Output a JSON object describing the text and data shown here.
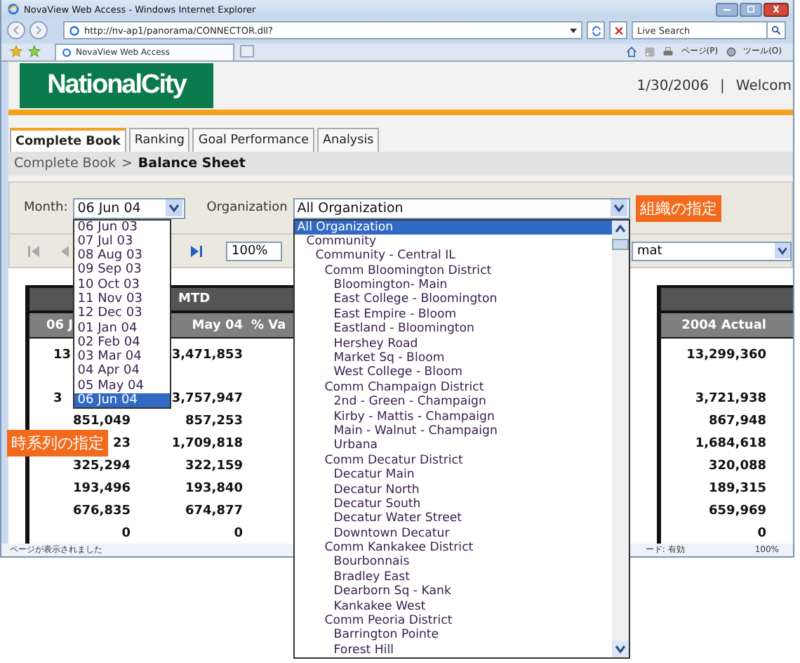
{
  "window": {
    "title": "NovaView Web Access - Windows Internet Explorer"
  },
  "address_bar": {
    "url": "http://nv-ap1/panorama/CONNECTOR.dll?"
  },
  "search": {
    "placeholder": "Live Search"
  },
  "browser_tabs": [
    {
      "label": "NovaView Web Access",
      "selected": true
    }
  ],
  "command_bar": [
    "ページ(P)",
    "ツール(O)"
  ],
  "header": {
    "logo": "NationalCity",
    "date": "1/30/2006",
    "separator": "|",
    "welcome": "Welcom"
  },
  "tabs": [
    {
      "label": "Complete Book",
      "selected": true
    },
    {
      "label": "Ranking",
      "selected": false
    },
    {
      "label": "Goal Performance",
      "selected": false
    },
    {
      "label": "Analysis",
      "selected": false
    }
  ],
  "breadcrumb": {
    "parent": "Complete Book",
    "separator": ">",
    "current": "Balance Sheet"
  },
  "filters": {
    "month": {
      "label": "Month:",
      "value": "06 Jun 04",
      "callout": "時系列の指定",
      "options": [
        {
          "label": "06 Jun 03",
          "selected": false
        },
        {
          "label": "07 Jul 03",
          "selected": false
        },
        {
          "label": "08 Aug 03",
          "selected": false
        },
        {
          "label": "09 Sep 03",
          "selected": false
        },
        {
          "label": "10 Oct 03",
          "selected": false
        },
        {
          "label": "11 Nov 03",
          "selected": false
        },
        {
          "label": "12 Dec 03",
          "selected": false
        },
        {
          "label": "01 Jan 04",
          "selected": false
        },
        {
          "label": "02 Feb 04",
          "selected": false
        },
        {
          "label": "03 Mar 04",
          "selected": false
        },
        {
          "label": "04 Apr 04",
          "selected": false
        },
        {
          "label": "05 May 04",
          "selected": false
        },
        {
          "label": "06 Jun 04",
          "selected": true
        }
      ]
    },
    "organization": {
      "label": "Organization",
      "value": "All Organization",
      "callout": "組織の指定",
      "options": [
        {
          "label": "All Organization",
          "selected": true,
          "children": [
            {
              "label": "Community",
              "selected": false,
              "children": [
                {
                  "label": "Community - Central IL",
                  "selected": false,
                  "children": [
                    {
                      "label": "Comm Bloomington District",
                      "selected": false,
                      "children": [
                        {
                          "label": "Bloomington- Main",
                          "selected": false
                        },
                        {
                          "label": "East College - Bloomington",
                          "selected": false
                        },
                        {
                          "label": "East Empire - Bloom",
                          "selected": false
                        },
                        {
                          "label": "Eastland - Bloomington",
                          "selected": false
                        },
                        {
                          "label": "Hershey Road",
                          "selected": false
                        },
                        {
                          "label": "Market Sq - Bloom",
                          "selected": false
                        },
                        {
                          "label": "West College - Bloom",
                          "selected": false
                        }
                      ]
                    },
                    {
                      "label": "Comm Champaign District",
                      "selected": false,
                      "children": [
                        {
                          "label": "2nd - Green - Champaign",
                          "selected": false
                        },
                        {
                          "label": "Kirby - Mattis - Champaign",
                          "selected": false
                        },
                        {
                          "label": "Main - Walnut - Champaign",
                          "selected": false
                        },
                        {
                          "label": "Urbana",
                          "selected": false
                        }
                      ]
                    },
                    {
                      "label": "Comm Decatur District",
                      "selected": false,
                      "children": [
                        {
                          "label": "Decatur Main",
                          "selected": false
                        },
                        {
                          "label": "Decatur North",
                          "selected": false
                        },
                        {
                          "label": "Decatur South",
                          "selected": false
                        },
                        {
                          "label": "Decatur Water Street",
                          "selected": false
                        },
                        {
                          "label": "Downtown Decatur",
                          "selected": false
                        }
                      ]
                    },
                    {
                      "label": "Comm Kankakee District",
                      "selected": false,
                      "children": [
                        {
                          "label": "Bourbonnais",
                          "selected": false
                        },
                        {
                          "label": "Bradley East",
                          "selected": false
                        },
                        {
                          "label": "Dearborn Sq - Kank",
                          "selected": false
                        },
                        {
                          "label": "Kankakee West",
                          "selected": false
                        }
                      ]
                    },
                    {
                      "label": "Comm Peoria District",
                      "selected": false,
                      "children": [
                        {
                          "label": "Barrington Pointe",
                          "selected": false
                        },
                        {
                          "label": "Forest Hill",
                          "selected": false
                        }
                      ]
                    }
                  ]
                }
              ]
            }
          ]
        }
      ]
    }
  },
  "toolbar": {
    "zoom": "100%",
    "format": "mat"
  },
  "left_table": {
    "group": "MTD",
    "columns": [
      "06 J",
      "May 04",
      "% Va"
    ],
    "rows": [
      {
        "kind": "covered",
        "cells": [
          "13",
          "3,471,853"
        ]
      },
      {
        "kind": "covered",
        "cells": [
          "3",
          "3,757,947"
        ]
      },
      {
        "kind": "full",
        "cells": [
          "851,049",
          "857,253"
        ]
      },
      {
        "kind": "full",
        "cells": [
          "23",
          "1,709,818"
        ]
      },
      {
        "kind": "full",
        "cells": [
          "325,294",
          "322,159"
        ]
      },
      {
        "kind": "full",
        "cells": [
          "193,496",
          "193,840"
        ]
      },
      {
        "kind": "full",
        "cells": [
          "676,835",
          "674,877"
        ]
      },
      {
        "kind": "full",
        "cells": [
          "0",
          "0"
        ]
      }
    ]
  },
  "right_table": {
    "columns": [
      "2004 Actual"
    ],
    "rows": [
      "13,299,360",
      "3,721,938",
      "867,948",
      "1,684,618",
      "320,088",
      "189,315",
      "659,969",
      "0"
    ]
  },
  "status_bar": {
    "text": "ページが表示されました",
    "mode": "ード: 有効",
    "zoom": "100%"
  }
}
